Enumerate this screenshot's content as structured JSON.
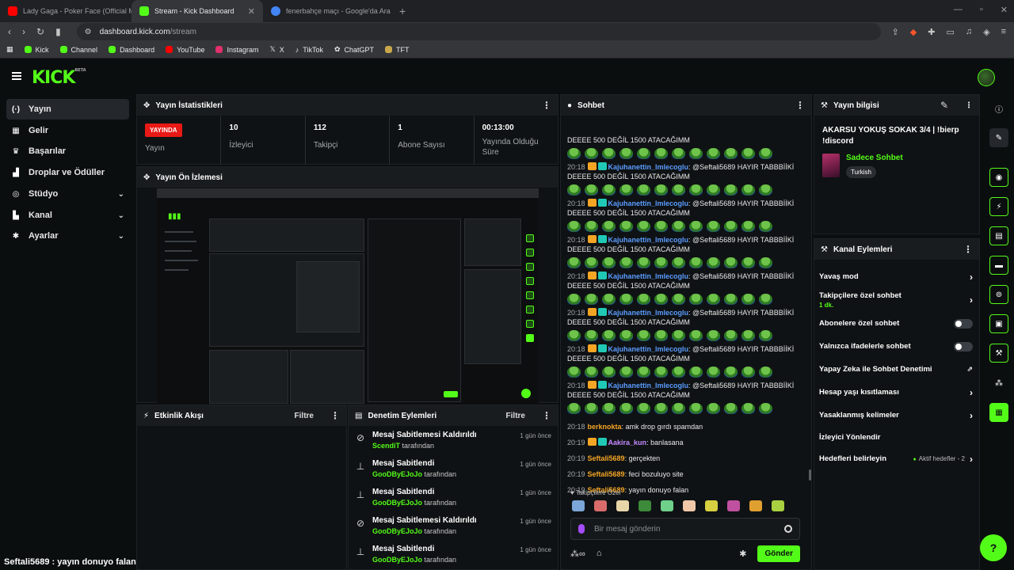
{
  "browser": {
    "tabs": [
      {
        "title": "Lady Gaga - Poker Face (Official M",
        "favicon_color": "#ff0000",
        "active": false
      },
      {
        "title": "Stream - Kick Dashboard",
        "favicon_color": "#53fc18",
        "active": true
      },
      {
        "title": "fenerbahçe maçı - Google'da Ara",
        "favicon_color": "#4285f4",
        "active": false
      }
    ],
    "url_host": "dashboard.kick.com",
    "url_path": "/stream",
    "bookmarks": [
      {
        "label": "Kick",
        "color": "#53fc18"
      },
      {
        "label": "Channel",
        "color": "#53fc18"
      },
      {
        "label": "Dashboard",
        "color": "#53fc18"
      },
      {
        "label": "YouTube",
        "color": "#ff0000"
      },
      {
        "label": "Instagram",
        "color": "#e1306c"
      },
      {
        "label": "X",
        "color": "#ffffff"
      },
      {
        "label": "TikTok",
        "color": "#ffffff"
      },
      {
        "label": "ChatGPT",
        "color": "#cccccc"
      },
      {
        "label": "TFT",
        "color": "#c8a84b"
      }
    ]
  },
  "brand": {
    "logo": "KICK",
    "beta": "BETA",
    "accent": "#53fc18"
  },
  "nav": {
    "items": [
      {
        "label": "Yayın",
        "icon": "broadcast-icon",
        "glyph": "(·)",
        "active": true,
        "chevron": false
      },
      {
        "label": "Gelir",
        "icon": "revenue-icon",
        "glyph": "▦",
        "active": false,
        "chevron": false
      },
      {
        "label": "Başarılar",
        "icon": "trophy-icon",
        "glyph": "♛",
        "active": false,
        "chevron": false
      },
      {
        "label": "Droplar ve Ödüller",
        "icon": "gift-icon",
        "glyph": "▟",
        "active": false,
        "chevron": false
      },
      {
        "label": "Stüdyo",
        "icon": "studio-icon",
        "glyph": "◎",
        "active": false,
        "chevron": true
      },
      {
        "label": "Kanal",
        "icon": "channel-icon",
        "glyph": "▙",
        "active": false,
        "chevron": true
      },
      {
        "label": "Ayarlar",
        "icon": "settings-icon",
        "glyph": "✱",
        "active": false,
        "chevron": true
      }
    ]
  },
  "bottom_chat": "Seftali5689 : yayın donuyo falan",
  "stats": {
    "title": "Yayın İstatistikleri",
    "live_badge": "YAYINDA",
    "live_label": "Yayın",
    "items": [
      {
        "value": "10",
        "label": "İzleyici"
      },
      {
        "value": "112",
        "label": "Takipçi"
      },
      {
        "value": "1",
        "label": "Abone Sayısı"
      },
      {
        "value": "00:13:00",
        "label": "Yayında Olduğu Süre"
      }
    ]
  },
  "preview": {
    "title": "Yayın Ön İzlemesi"
  },
  "activity": {
    "title": "Etkinlik Akışı",
    "filter": "Filtre"
  },
  "moderation": {
    "title": "Denetim Eylemleri",
    "filter": "Filtre",
    "by_suffix": "tarafından",
    "items": [
      {
        "action": "Mesaj Sabitlemesi Kaldırıldı",
        "user": "ScendiT",
        "time": "1 gün önce",
        "icon": "unpin-icon"
      },
      {
        "action": "Mesaj Sabitlendi",
        "user": "GooDByEJoJo",
        "time": "1 gün önce",
        "icon": "pin-icon"
      },
      {
        "action": "Mesaj Sabitlendi",
        "user": "GooDByEJoJo",
        "time": "1 gün önce",
        "icon": "pin-icon"
      },
      {
        "action": "Mesaj Sabitlemesi Kaldırıldı",
        "user": "GooDByEJoJo",
        "time": "1 gün önce",
        "icon": "unpin-icon"
      },
      {
        "action": "Mesaj Sabitlendi",
        "user": "GooDByEJoJo",
        "time": "1 gün önce",
        "icon": "pin-icon"
      }
    ]
  },
  "chat": {
    "title": "Sohbet",
    "spam_text": "DEEEE 500 DEĞİL 1500 ATACAĞIMM",
    "spam_user": "Kajuhanettin_lmlecoglu",
    "spam_time": "20:18",
    "spam_msg": ": @Seftali5689 HAYIR TABBBİİKİ",
    "messages": [
      {
        "time": "20:18",
        "user": "berknokta",
        "color": "#f5a524",
        "text": ": amk drop gırdı spamdan",
        "badges": []
      },
      {
        "time": "20:19",
        "user": "Aakira_kun",
        "color": "#c58bff",
        "text": ": banlasana",
        "badges": [
          "crown",
          "sub"
        ]
      },
      {
        "time": "20:19",
        "user": "Seftali5689",
        "color": "#f5a524",
        "text": ": gerçekten",
        "badges": []
      },
      {
        "time": "20:19",
        "user": "Seftali5689",
        "color": "#f5a524",
        "text": ": feci bozuluyo site",
        "badges": []
      },
      {
        "time": "20:19",
        "user": "Seftali5689",
        "color": "#f5a524",
        "text": ": yayın donuyo falan",
        "badges": []
      }
    ],
    "followers_label": "♥ Takipçilere Özel",
    "input_placeholder": "Bir mesaj gönderin",
    "send_label": "Gönder"
  },
  "stream_info": {
    "title": "Yayın bilgisi",
    "stream_title": "AKARSU YOKUŞ SOKAK 3/4 | !bierp !discord",
    "category": "Sadece Sohbet",
    "language": "Turkish"
  },
  "channel_actions": {
    "title": "Kanal Eylemleri",
    "items": [
      {
        "label": "Yavaş mod",
        "control": "chevron"
      },
      {
        "label": "Takipçilere özel sohbet",
        "sub": "1 dk.",
        "control": "chevron"
      },
      {
        "label": "Abonelere özel sohbet",
        "control": "toggle"
      },
      {
        "label": "Yalnızca ifadelerle sohbet",
        "control": "toggle"
      },
      {
        "label": "Yapay Zeka ile Sohbet Denetimi",
        "control": "external"
      },
      {
        "label": "Hesap yaşı kısıtlaması",
        "control": "chevron"
      },
      {
        "label": "Yasaklanmış kelimeler",
        "control": "chevron"
      },
      {
        "label": "İzleyici Yönlendir",
        "control": "none"
      },
      {
        "label": "Hedefleri belirleyin",
        "badge": "Aktif hedefler - 2",
        "control": "chevron"
      }
    ]
  }
}
